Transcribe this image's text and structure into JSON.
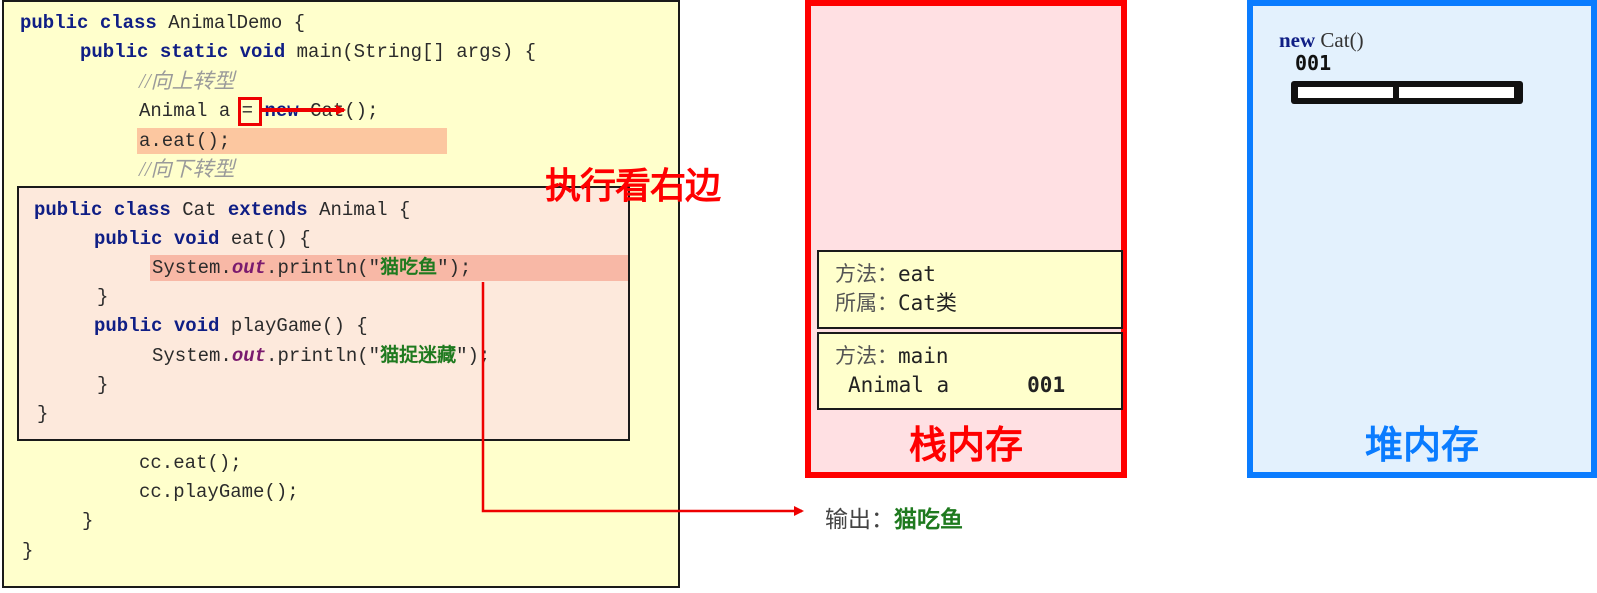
{
  "code_main": {
    "line1": [
      "public class",
      "AnimalDemo {"
    ],
    "line2": [
      "public static void",
      "main(String[] args) {"
    ],
    "comment_upcast": "//向上转型",
    "line4": [
      "Animal ",
      "a",
      " = ",
      "new",
      " Cat();"
    ],
    "line5": "a.eat();",
    "comment_downcast": "//向下转型",
    "line_cc_eat": "cc.eat();",
    "line_cc_play": "cc.playGame();",
    "close_method": "}",
    "close_class": "}"
  },
  "code_cat": {
    "line1": [
      "public class",
      "Cat",
      "extends",
      "Animal {"
    ],
    "line2": [
      "public void",
      "eat() {"
    ],
    "line3": [
      "System.",
      "out",
      ".println(\"",
      "猫吃鱼",
      "\");"
    ],
    "line4": "}",
    "line5": [
      "public void",
      "playGame() {"
    ],
    "line6": [
      "System.",
      "out",
      ".println(\"",
      "猫捉迷藏",
      "\");"
    ],
    "line7": "}",
    "line8": "}"
  },
  "annotation": "执行看右边",
  "stack": {
    "title": "栈内存",
    "frames": [
      {
        "method_label": "方法：",
        "method": "eat",
        "owner_label": "所属：",
        "owner": "Cat类"
      },
      {
        "method_label": "方法：",
        "method": "main",
        "var": "Animal a",
        "address": "001"
      }
    ],
    "color": "#ff0000"
  },
  "heap": {
    "title": "堆内存",
    "object_new": "new",
    "object_type": "Cat()",
    "address": "001",
    "color": "#0a7cff"
  },
  "output": {
    "label": "输出：",
    "value": "猫吃鱼"
  }
}
